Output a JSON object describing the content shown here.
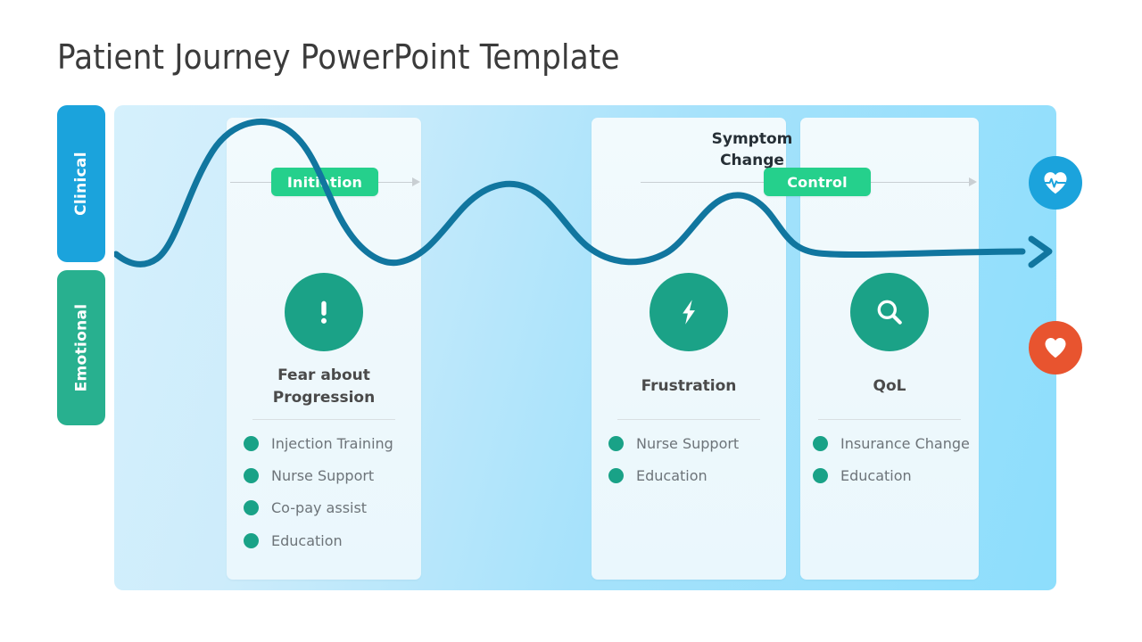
{
  "slide": {
    "title": "Patient Journey PowerPoint Template"
  },
  "axis": {
    "clinical": {
      "label": "Clinical",
      "color": "#1BA3DC"
    },
    "emotional": {
      "label": "Emotional",
      "color": "#28B08F"
    }
  },
  "timeline": {
    "badges": [
      {
        "label": "Initiation",
        "color": "#25D08C"
      },
      {
        "label": "Control",
        "color": "#25D08C"
      }
    ],
    "annotation": "Symptom\nChange",
    "annotation_line1": "Symptom",
    "annotation_line2": "Change"
  },
  "stages": [
    {
      "badge": "Initiation",
      "icon": "exclamation-icon",
      "heading_line1": "Fear about",
      "heading_line2": "Progression",
      "bullets": [
        "Injection Training",
        "Nurse Support",
        "Co-pay assist",
        "Education"
      ]
    },
    {
      "badge": "",
      "icon": "bolt-icon",
      "heading_line1": "Frustration",
      "heading_line2": "",
      "bullets": [
        "Nurse Support",
        "Education"
      ]
    },
    {
      "badge": "Control",
      "icon": "magnifier-icon",
      "heading_line1": "QoL",
      "heading_line2": "",
      "bullets": [
        "Insurance Change",
        "Education"
      ]
    }
  ],
  "side_icons": [
    {
      "name": "heartbeat-icon",
      "color": "#1BA3DC"
    },
    {
      "name": "heart-icon",
      "color": "#E8542F"
    }
  ],
  "colors": {
    "wave": "#11769F",
    "icon_circle": "#1BA287",
    "bullet_dot": "#19A287",
    "panel_light": "#d5f0fc",
    "panel_dark": "#8ddefc",
    "card": "#eef8fc",
    "text_heading": "#4a4a4a",
    "text_bullet": "#6d7479",
    "title": "#3b3b3b"
  }
}
